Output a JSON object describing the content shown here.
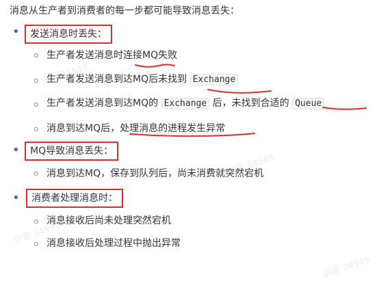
{
  "intro": "消息从生产者到消费者的每一步都可能导致消息丢失：",
  "sections": [
    {
      "label": "发送消息时丢失：",
      "items": [
        {
          "parts": [
            "生产者发送消息时连接MQ失败"
          ]
        },
        {
          "parts": [
            "生产者发送消息到达MQ后未找到",
            "Exchange"
          ]
        },
        {
          "parts": [
            "生产者发送消息到达MQ的",
            "Exchange",
            "后，未找到合适的",
            "Queue"
          ]
        },
        {
          "parts": [
            "消息到达MQ后，处理消息的进程发生异常"
          ]
        }
      ]
    },
    {
      "label": "MQ导致消息丢失：",
      "items": [
        {
          "parts": [
            "消息到达MQ，保存到队列后，尚未消费就突然宕机"
          ]
        }
      ]
    },
    {
      "label": "消费者处理消息时：",
      "items": [
        {
          "parts": [
            "消息接收后尚未处理突然宕机"
          ]
        },
        {
          "parts": [
            "消息接收后处理过程中抛出异常"
          ]
        }
      ]
    }
  ],
  "watermark": "访客 34549",
  "colors": {
    "bullet": "#3f5fd4",
    "highlight_box": "#e32b2b",
    "underline": "#e32b2b",
    "text": "#333333"
  }
}
